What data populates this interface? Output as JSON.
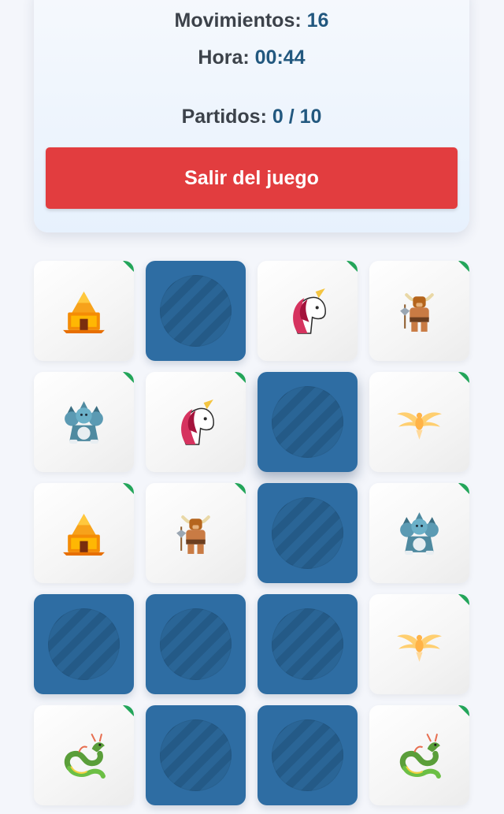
{
  "stats": {
    "moves_label": "Movimientos:",
    "moves_value": "16",
    "time_label": "Hora:",
    "time_value": "00:44",
    "matches_label": "Partidos:",
    "matches_value": "0 / 10"
  },
  "exit_button": {
    "label": "Salir del juego"
  },
  "board": {
    "columns": 4,
    "rows": 5,
    "cards": [
      {
        "state": "face",
        "icon": "sphinx-icon",
        "matched": true
      },
      {
        "state": "back",
        "icon": "card-back-icon",
        "matched": false
      },
      {
        "state": "face",
        "icon": "unicorn-icon",
        "matched": true
      },
      {
        "state": "face",
        "icon": "minotaur-icon",
        "matched": true
      },
      {
        "state": "face",
        "icon": "cerberus-icon",
        "matched": true
      },
      {
        "state": "face",
        "icon": "unicorn-icon",
        "matched": true
      },
      {
        "state": "back",
        "icon": "card-back-icon",
        "matched": false
      },
      {
        "state": "face",
        "icon": "phoenix-icon",
        "matched": true
      },
      {
        "state": "face",
        "icon": "sphinx-icon",
        "matched": true
      },
      {
        "state": "face",
        "icon": "minotaur-icon",
        "matched": true
      },
      {
        "state": "back",
        "icon": "card-back-icon",
        "matched": false
      },
      {
        "state": "face",
        "icon": "cerberus-icon",
        "matched": true
      },
      {
        "state": "back",
        "icon": "card-back-icon",
        "matched": false
      },
      {
        "state": "back",
        "icon": "card-back-icon",
        "matched": false
      },
      {
        "state": "back",
        "icon": "card-back-icon",
        "matched": false
      },
      {
        "state": "face",
        "icon": "phoenix-icon",
        "matched": true
      },
      {
        "state": "face",
        "icon": "dragon-icon",
        "matched": true
      },
      {
        "state": "back",
        "icon": "card-back-icon",
        "matched": false
      },
      {
        "state": "back",
        "icon": "card-back-icon",
        "matched": false
      },
      {
        "state": "face",
        "icon": "dragon-icon",
        "matched": true
      }
    ]
  },
  "colors": {
    "accent": "#22587f",
    "danger": "#e23d3f",
    "card_back": "#2e6da3",
    "matched_marker": "#23a55a"
  }
}
